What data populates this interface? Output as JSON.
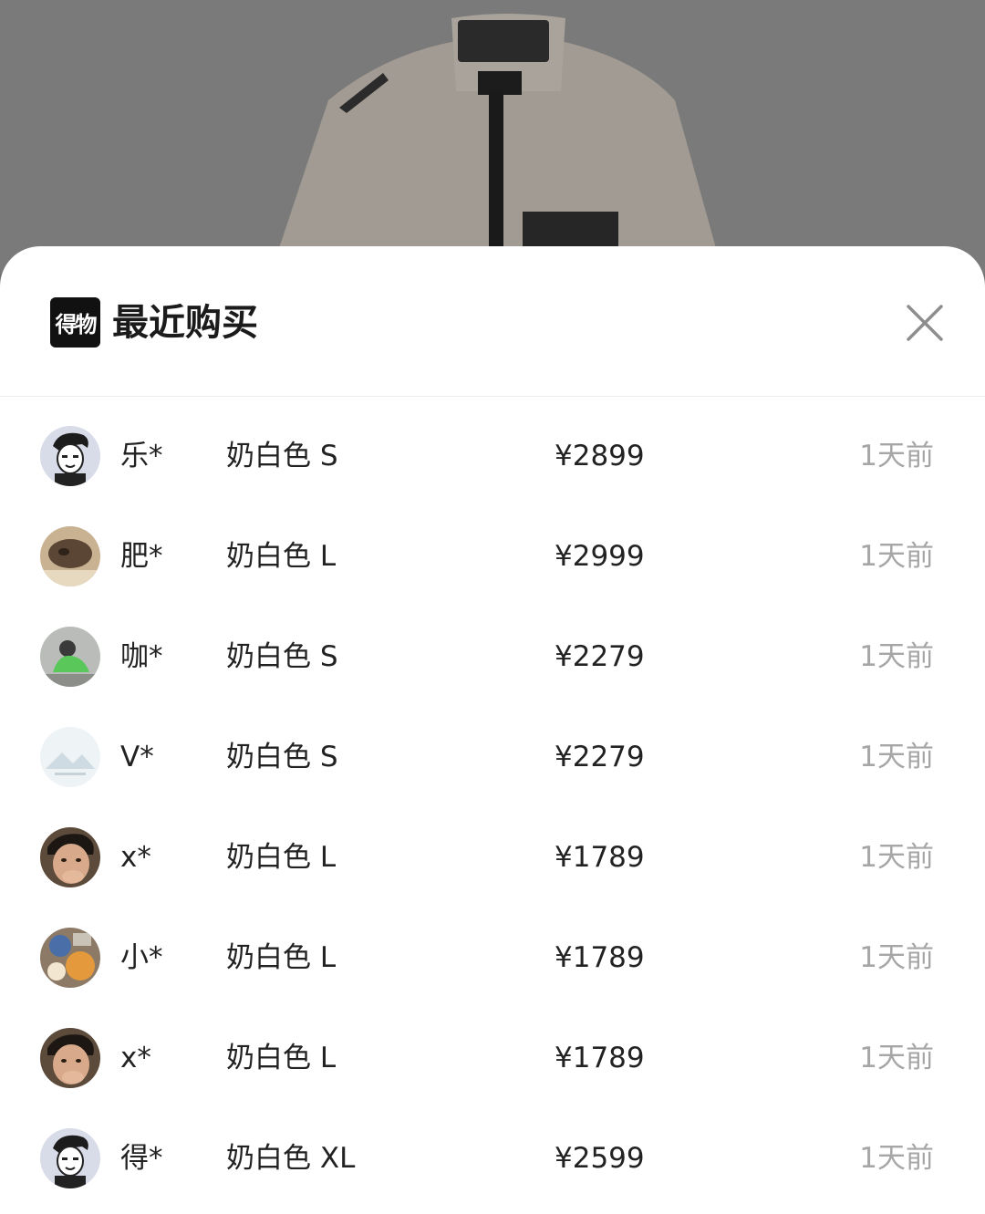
{
  "sheet": {
    "brand_logo_text": "得物",
    "title": "最近购买",
    "close_icon": "close-icon"
  },
  "purchases": [
    {
      "user": "乐*",
      "variant": "奶白色 S",
      "price": "¥2899",
      "time": "1天前",
      "avatar": "cartoon"
    },
    {
      "user": "肥*",
      "variant": "奶白色 L",
      "price": "¥2999",
      "time": "1天前",
      "avatar": "cat"
    },
    {
      "user": "咖*",
      "variant": "奶白色 S",
      "price": "¥2279",
      "time": "1天前",
      "avatar": "green"
    },
    {
      "user": "V*",
      "variant": "奶白色 S",
      "price": "¥2279",
      "time": "1天前",
      "avatar": "landscape"
    },
    {
      "user": "x*",
      "variant": "奶白色 L",
      "price": "¥1789",
      "time": "1天前",
      "avatar": "face"
    },
    {
      "user": "小*",
      "variant": "奶白色 L",
      "price": "¥1789",
      "time": "1天前",
      "avatar": "food"
    },
    {
      "user": "x*",
      "variant": "奶白色 L",
      "price": "¥1789",
      "time": "1天前",
      "avatar": "face"
    },
    {
      "user": "得*",
      "variant": "奶白色 XL",
      "price": "¥2599",
      "time": "1天前",
      "avatar": "cartoon"
    }
  ]
}
